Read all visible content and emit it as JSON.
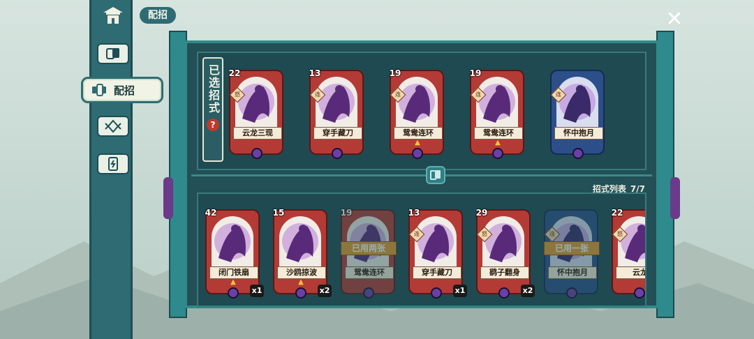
{
  "header": {
    "title": "配招"
  },
  "nav": {
    "active_label": "配招",
    "items": [
      {
        "icon": "pavilion-icon"
      },
      {
        "icon": "cards-icon"
      },
      {
        "icon": "deck-icon",
        "label": "配招"
      },
      {
        "icon": "emblem-icon"
      },
      {
        "icon": "card-device-icon"
      }
    ]
  },
  "selected": {
    "label": "已选招式",
    "help": "?",
    "cards": [
      {
        "name": "云龙三现",
        "cost": "22",
        "color": "red",
        "tag": "怒"
      },
      {
        "name": "穿手藏刀",
        "cost": "13",
        "color": "red",
        "tag": "连"
      },
      {
        "name": "鸳鸯连环",
        "cost": "19",
        "color": "red",
        "tag": "连",
        "upgraded": true
      },
      {
        "name": "鸳鸯连环",
        "cost": "19",
        "color": "red",
        "tag": "连",
        "upgraded": true
      },
      {
        "name": "怀中抱月",
        "cost": "",
        "color": "blue",
        "tag": "连"
      }
    ]
  },
  "list": {
    "label": "招式列表",
    "count": "7/7",
    "cards": [
      {
        "name": "闭门铁扇",
        "cost": "42",
        "color": "red",
        "upgraded": true,
        "count": "x1"
      },
      {
        "name": "沙鸥掠波",
        "cost": "15",
        "color": "red",
        "upgraded": true,
        "count": "x2"
      },
      {
        "name": "鸳鸯连环",
        "cost": "19",
        "color": "red",
        "faded": true,
        "used": "已用两张"
      },
      {
        "name": "穿手藏刀",
        "cost": "13",
        "color": "red",
        "tag": "连",
        "count": "x1"
      },
      {
        "name": "鹞子翻身",
        "cost": "29",
        "color": "red",
        "tag": "怒",
        "count": "x2"
      },
      {
        "name": "怀中抱月",
        "cost": "",
        "color": "blue",
        "tag": "连",
        "faded": true,
        "used": "已用一张"
      },
      {
        "name": "云龙",
        "cost": "22",
        "color": "red",
        "tag": "怒"
      }
    ]
  },
  "colors": {
    "teal": "#2f6b72",
    "card_red": "#b43a36",
    "card_blue": "#2c4f8a",
    "badge_orange": "#e59b2e",
    "purple": "#6b3fa8"
  }
}
